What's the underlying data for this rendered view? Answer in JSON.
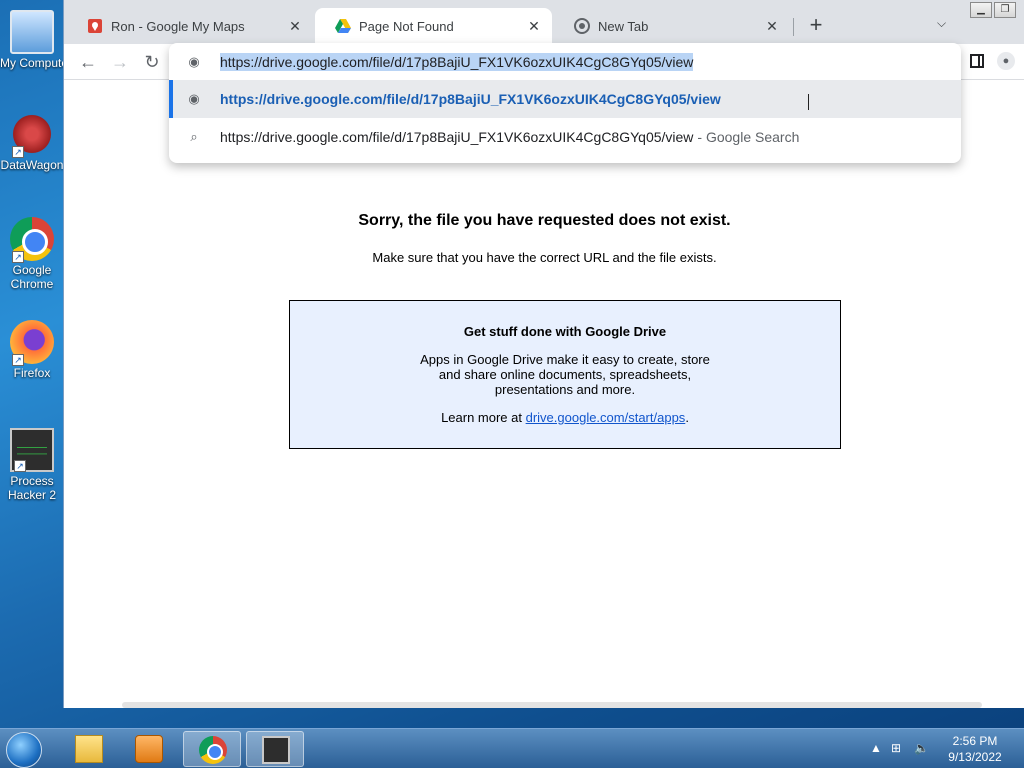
{
  "desktop": {
    "icons": [
      {
        "label": "My Computer"
      },
      {
        "label": "DataWagon"
      },
      {
        "label": "Google Chrome"
      },
      {
        "label": "Firefox"
      },
      {
        "label": "Process Hacker 2"
      }
    ]
  },
  "browser": {
    "tabs": [
      {
        "title": "Ron - Google My Maps",
        "icon": "maps-pin-icon",
        "active": false
      },
      {
        "title": "Page Not Found",
        "icon": "google-drive-icon",
        "active": true
      },
      {
        "title": "New Tab",
        "icon": "chrome-icon",
        "active": false
      }
    ],
    "omnibox": {
      "input_text": "https://drive.google.com/file/d/17p8BajiU_FX1VK6ozxUIK4CgC8GYq05/view",
      "suggestions": [
        {
          "text": "https://drive.google.com/file/d/17p8BajiU_FX1VK6ozxUIK4CgC8GYq05/view",
          "suffix": "",
          "icon": "globe-icon"
        },
        {
          "text": "https://drive.google.com/file/d/17p8BajiU_FX1VK6ozxUIK4CgC8GYq05/view",
          "suffix": "- Google Search",
          "icon": "search-icon"
        }
      ]
    }
  },
  "page": {
    "title": "Sorry, the file you have requested does not exist.",
    "subtitle": "Make sure that you have the correct URL and the file exists.",
    "box": {
      "heading": "Get stuff done with Google Drive",
      "body": "Apps in Google Drive make it easy to create, store and share online documents, spreadsheets, presentations and more.",
      "learn_prefix": "Learn more at ",
      "learn_link": "drive.google.com/start/apps",
      "learn_suffix": "."
    }
  },
  "taskbar": {
    "time": "2:56 PM",
    "date": "9/13/2022"
  },
  "colors": {
    "accent": "#1a73e8",
    "link": "#1155cc",
    "info_box_bg": "#e8f0fe"
  }
}
